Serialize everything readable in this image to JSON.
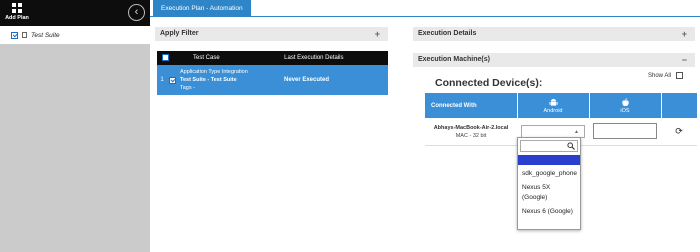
{
  "sidebar": {
    "add_plan_label": "Add Plan",
    "collapse_icon": "chevron-left-circle",
    "tree": [
      {
        "label": "Test Suite",
        "checked": true
      }
    ]
  },
  "tabs": [
    {
      "label": "Execution Plan - Automation",
      "active": true
    }
  ],
  "apply_filter": {
    "title": "Apply Filter",
    "columns": [
      "Test Case",
      "Last Execution Details"
    ],
    "rows": [
      {
        "index": "1",
        "type_line": "Application Type Integration",
        "test_line": "Test Suite - Test Suite",
        "tags_line": "Tags -",
        "last_execution": "Never Executed",
        "checked": true
      }
    ]
  },
  "execution_details": {
    "title": "Execution Details"
  },
  "execution_machines": {
    "title": "Execution Machine(s)",
    "connected_title": "Connected Device(s):",
    "show_all_label": "Show All",
    "columns": {
      "connected_with": "Connected With",
      "android": "Android",
      "ios": "iOS"
    },
    "device": {
      "name": "Abhays-MacBook-Air-2.local",
      "os": "MAC - 32 bit"
    },
    "dropdown_options": [
      "sdk_google_phone",
      "Nexus 5X (Google)",
      "Nexus 6 (Google)"
    ],
    "refresh_icon": "refresh-icon"
  },
  "colors": {
    "accent": "#2e86c8",
    "row_selected": "#3a8fd6",
    "header_dark": "#0d0d0d",
    "dropdown_highlight": "#2b3fcf"
  }
}
